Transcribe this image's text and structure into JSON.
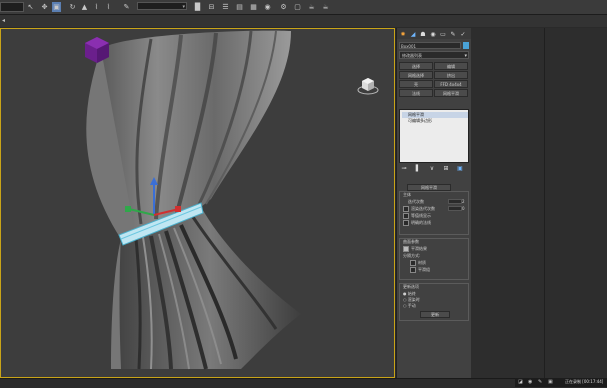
{
  "toolbar": {
    "dropdown_value": "",
    "selection_filter": ""
  },
  "command_panel": {
    "object_name": "Box001",
    "modifier_list": "修改器列表",
    "buttons": [
      "选择",
      "编辑",
      "网格选择",
      "挤出",
      "壳",
      "FFD 4x4x4",
      "法线",
      "网格平滑"
    ],
    "stack_items": [
      {
        "label": "网格平滑",
        "selected": true
      },
      {
        "label": "可编辑多边形",
        "selected": false
      }
    ],
    "rollout_title": "网格平滑",
    "subdivision": {
      "label": "主体",
      "iterations_label": "迭代次数",
      "iterations_value": "2",
      "render_iter_label": "渲染迭代次数",
      "render_iter_value": "0",
      "isoline_label": "等值线显示",
      "explicit_normals_label": "明确的法线"
    },
    "surface": {
      "label": "曲面参数",
      "smooth_result_label": "平滑结果",
      "separate_label": "分隔方式:",
      "materials_label": "材质",
      "smoothing_groups_label": "平滑组"
    },
    "update": {
      "label": "更新选项",
      "always_label": "始终",
      "on_render_label": "渲染时",
      "manual_label": "手动",
      "update_button": "更新"
    }
  },
  "tray": {
    "recording_text": "正在录制 [00:17:44]"
  }
}
